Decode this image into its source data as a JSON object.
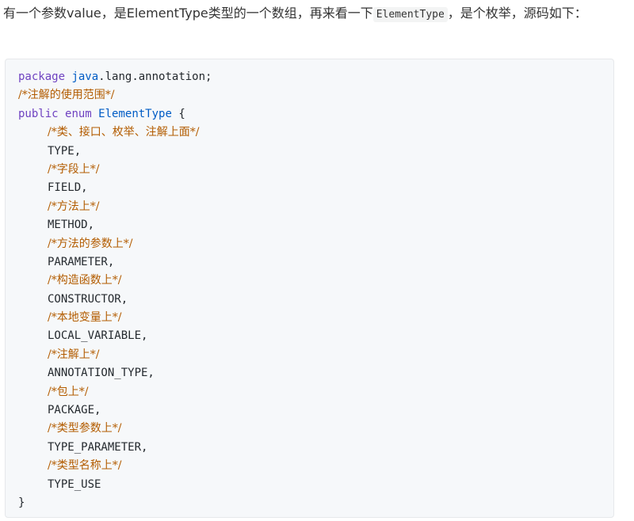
{
  "intro": {
    "text_before": "有一个参数value，是ElementType类型的一个数组，再来看一下",
    "inline_code": "ElementType",
    "text_after": "，是个枚举，源码如下："
  },
  "code": {
    "line1": {
      "kw": "package",
      "pkg": "java",
      "rest": ".lang.annotation;"
    },
    "line2": {
      "comment": "/*注解的使用范围*/"
    },
    "line3": {
      "kw1": "public",
      "kw2": "enum",
      "cls": "ElementType",
      "rest": " {"
    },
    "entries": [
      {
        "comment": "/*类、接口、枚举、注解上面*/",
        "value": "TYPE,"
      },
      {
        "comment": "/*字段上*/",
        "value": "FIELD,"
      },
      {
        "comment": "/*方法上*/",
        "value": "METHOD,"
      },
      {
        "comment": "/*方法的参数上*/",
        "value": "PARAMETER,"
      },
      {
        "comment": "/*构造函数上*/",
        "value": "CONSTRUCTOR,"
      },
      {
        "comment": "/*本地变量上*/",
        "value": "LOCAL_VARIABLE,"
      },
      {
        "comment": "/*注解上*/",
        "value": "ANNOTATION_TYPE,"
      },
      {
        "comment": "/*包上*/",
        "value": "PACKAGE,"
      },
      {
        "comment": "/*类型参数上*/",
        "value": "TYPE_PARAMETER,"
      },
      {
        "comment": "/*类型名称上*/",
        "value": "TYPE_USE"
      }
    ],
    "closing": "}"
  }
}
